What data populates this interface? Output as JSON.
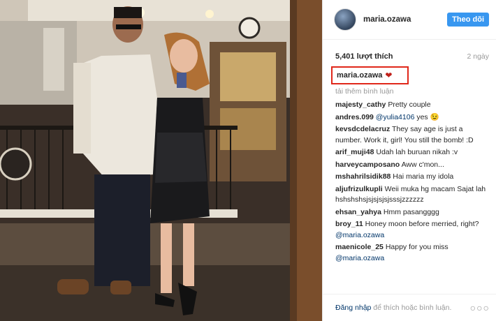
{
  "post": {
    "username": "maria.ozawa",
    "follow_label": "Theo dõi",
    "likes": "5,401 lượt thích",
    "time": "2 ngày",
    "caption_user": "maria.ozawa",
    "load_more": "tải thêm bình luận",
    "comments": [
      {
        "user": "majesty_cathy",
        "text": "Pretty couple"
      },
      {
        "user": "andres.099",
        "mention": "@yulia4106",
        "text": " yes 😉"
      },
      {
        "user": "kevsdcdelacruz",
        "text": "They say age is just a number. Work it, girl! You still the bomb! :D"
      },
      {
        "user": "arif_muji48",
        "text": "Udah lah buruan nikah :v"
      },
      {
        "user": "harveycamposano",
        "text": "Aww c'mon..."
      },
      {
        "user": "mshahrilsidik88",
        "text": "Hai maria my idola"
      },
      {
        "user": "aljufrizulkupli",
        "text": "Weii muka hg macam Sajat lah hshshshsjsjsjsjsjsssjzzzzzz"
      },
      {
        "user": "ehsan_yahya",
        "text": "Hmm pasangggg"
      },
      {
        "user": "broy_11",
        "text": "Honey moon before merried, right? ",
        "mention_after": "@maria.ozawa"
      },
      {
        "user": "maenicole_25",
        "text": "Happy for you miss ",
        "mention_after": "@maria.ozawa"
      }
    ],
    "footer_login": "Đăng nhập",
    "footer_rest": " để thích hoặc bình luận.",
    "more": "○○○"
  },
  "colors": {
    "follow_bg": "#3897f0",
    "highlight_border": "#e0271a",
    "heart": "#c0201a"
  }
}
